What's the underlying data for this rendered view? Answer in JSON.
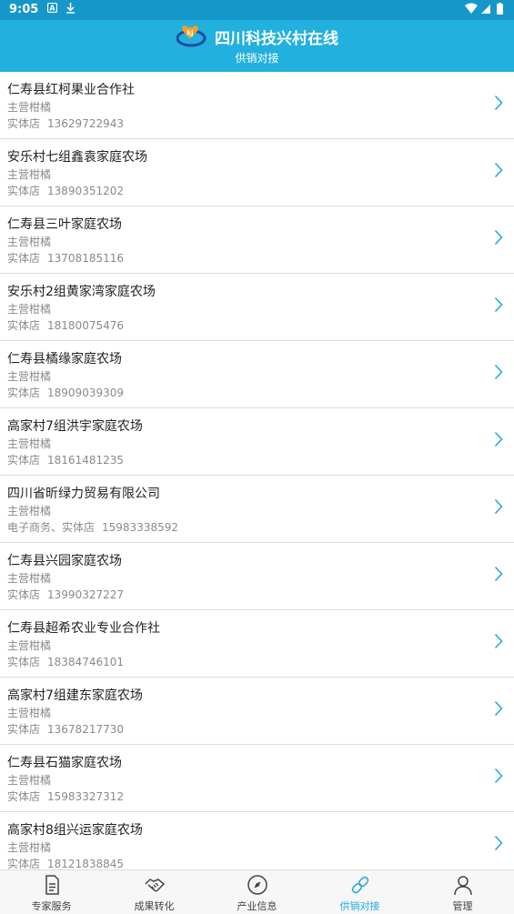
{
  "status_bar": {
    "time": "9:05"
  },
  "header": {
    "title": "四川科技兴村在线",
    "subtitle": "供销对接"
  },
  "listings": [
    {
      "name": "仁寿县红柯果业合作社",
      "business": "主营柑橘",
      "channel": "实体店",
      "phone": "13629722943"
    },
    {
      "name": "安乐村七组鑫袁家庭农场",
      "business": "主营柑橘",
      "channel": "实体店",
      "phone": "13890351202"
    },
    {
      "name": "仁寿县三叶家庭农场",
      "business": "主营柑橘",
      "channel": "实体店",
      "phone": "13708185116"
    },
    {
      "name": "安乐村2组黄家湾家庭农场",
      "business": "主营柑橘",
      "channel": "实体店",
      "phone": "18180075476"
    },
    {
      "name": "仁寿县橘缘家庭农场",
      "business": "主营柑橘",
      "channel": "实体店",
      "phone": "18909039309"
    },
    {
      "name": "高家村7组洪宇家庭农场",
      "business": "主营柑橘",
      "channel": "实体店",
      "phone": "18161481235"
    },
    {
      "name": "四川省昕绿力贸易有限公司",
      "business": "主营柑橘",
      "channel": "电子商务、实体店",
      "phone": "15983338592"
    },
    {
      "name": "仁寿县兴园家庭农场",
      "business": "主营柑橘",
      "channel": "实体店",
      "phone": "13990327227"
    },
    {
      "name": "仁寿县超希农业专业合作社",
      "business": "主营柑橘",
      "channel": "实体店",
      "phone": "18384746101"
    },
    {
      "name": "高家村7组建东家庭农场",
      "business": "主营柑橘",
      "channel": "实体店",
      "phone": "13678217730"
    },
    {
      "name": "仁寿县石猫家庭农场",
      "business": "主营柑橘",
      "channel": "实体店",
      "phone": "15983327312"
    },
    {
      "name": "高家村8组兴运家庭农场",
      "business": "主营柑橘",
      "channel": "实体店",
      "phone": "18121838845"
    }
  ],
  "tabs": [
    {
      "label": "专家服务",
      "icon": "document-icon",
      "active": false
    },
    {
      "label": "成果转化",
      "icon": "handshake-icon",
      "active": false
    },
    {
      "label": "产业信息",
      "icon": "compass-icon",
      "active": false
    },
    {
      "label": "供销对接",
      "icon": "link-icon",
      "active": true
    },
    {
      "label": "管理",
      "icon": "person-icon",
      "active": false
    }
  ],
  "colors": {
    "header": "#22b0de",
    "status_bar": "#1597c9",
    "accent": "#27a9e1",
    "chevron": "#27a9e1"
  }
}
